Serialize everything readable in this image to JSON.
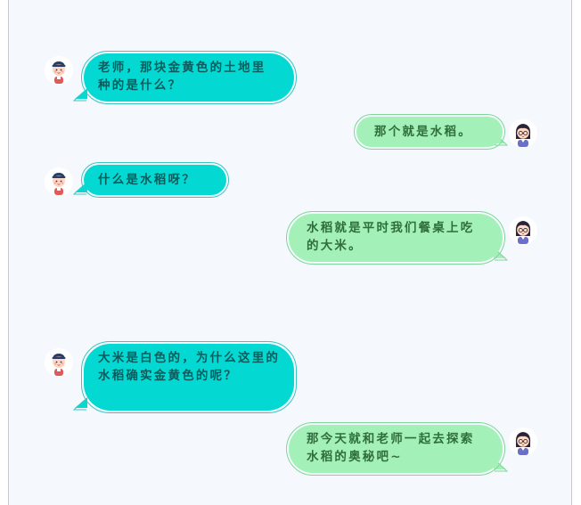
{
  "colors": {
    "panel_bg": "#f5f9fe",
    "panel_border": "#a9d3f2",
    "teacher_bubble": "#03d9d2",
    "teacher_text": "#0c5b5c",
    "student_bubble": "#a3f1b8",
    "student_text": "#2f6e3c"
  },
  "avatars": {
    "left": "boy-student-avatar-icon",
    "right": "teacher-with-glasses-avatar-icon"
  },
  "messages": [
    {
      "side": "left",
      "text": "老师，那块金黄色的土地里种的是什么？"
    },
    {
      "side": "right",
      "text": "那个就是水稻。"
    },
    {
      "side": "left",
      "text": "什么是水稻呀？"
    },
    {
      "side": "right",
      "text": "水稻就是平时我们餐桌上吃的大米。"
    },
    {
      "side": "left",
      "text": "大米是白色的，为什么这里的水稻确实金黄色的呢？"
    },
    {
      "side": "right",
      "text": "那今天就和老师一起去探索水稻的奥秘吧~"
    }
  ]
}
